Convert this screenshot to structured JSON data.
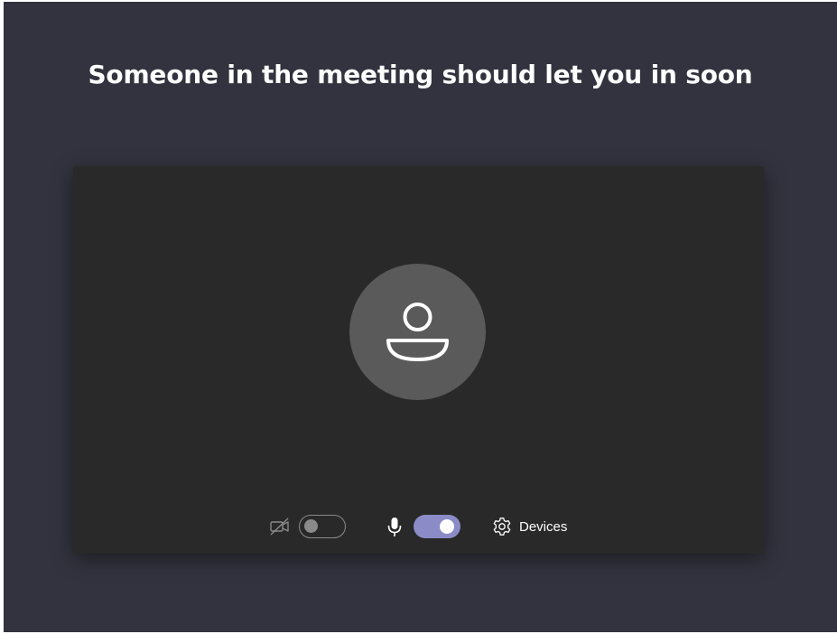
{
  "heading": "Someone in the meeting should let you in soon",
  "controls": {
    "camera": {
      "icon": "video-off-icon",
      "enabled": false
    },
    "microphone": {
      "icon": "microphone-icon",
      "enabled": true
    },
    "devices": {
      "icon": "gear-icon",
      "label": "Devices"
    }
  },
  "avatar": {
    "icon": "person-icon"
  },
  "colors": {
    "background": "#33333f",
    "preview": "#292929",
    "avatar": "#5a5a5a",
    "toggle_on": "#8b8cc7",
    "toggle_off": "#8a8a8a"
  }
}
